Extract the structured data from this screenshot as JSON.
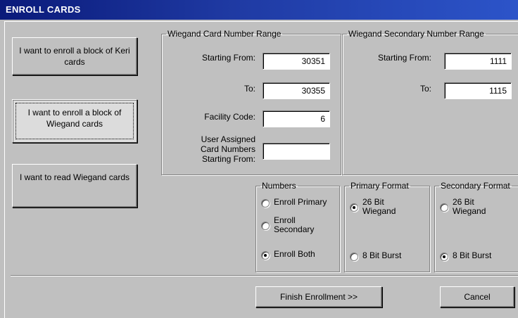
{
  "window": {
    "title": "ENROLL CARDS"
  },
  "actions": {
    "enroll_keri": "I want to enroll a block of Keri cards",
    "enroll_wiegand": "I want to enroll a block of Wiegand cards",
    "read_wiegand": "I want to read Wiegand cards"
  },
  "card_range": {
    "legend": "Wiegand Card Number Range",
    "starting_from_label": "Starting From:",
    "starting_from_value": "30351",
    "to_label": "To:",
    "to_value": "30355",
    "facility_code_label": "Facility Code:",
    "facility_code_value": "6",
    "user_assigned_label_1": "User Assigned",
    "user_assigned_label_2": "Card Numbers",
    "user_assigned_label_3": "Starting From:",
    "user_assigned_value": ""
  },
  "secondary_range": {
    "legend": "Wiegand Secondary Number Range",
    "starting_from_label": "Starting From:",
    "starting_from_value": "1111",
    "to_label": "To:",
    "to_value": "1115"
  },
  "numbers": {
    "legend": "Numbers",
    "options": [
      {
        "label": "Enroll Primary",
        "selected": false
      },
      {
        "label": "Enroll Secondary",
        "selected": false
      },
      {
        "label": "Enroll Both",
        "selected": true
      }
    ]
  },
  "primary_format": {
    "legend": "Primary Format",
    "options": [
      {
        "label": "26 Bit Wiegand",
        "selected": true
      },
      {
        "label": "8 Bit Burst",
        "selected": false
      }
    ]
  },
  "secondary_format": {
    "legend": "Secondary Format",
    "options": [
      {
        "label": "26 Bit Wiegand",
        "selected": false
      },
      {
        "label": "8 Bit Burst",
        "selected": true
      }
    ]
  },
  "footer": {
    "finish_label": "Finish Enrollment >>",
    "cancel_label": "Cancel"
  }
}
